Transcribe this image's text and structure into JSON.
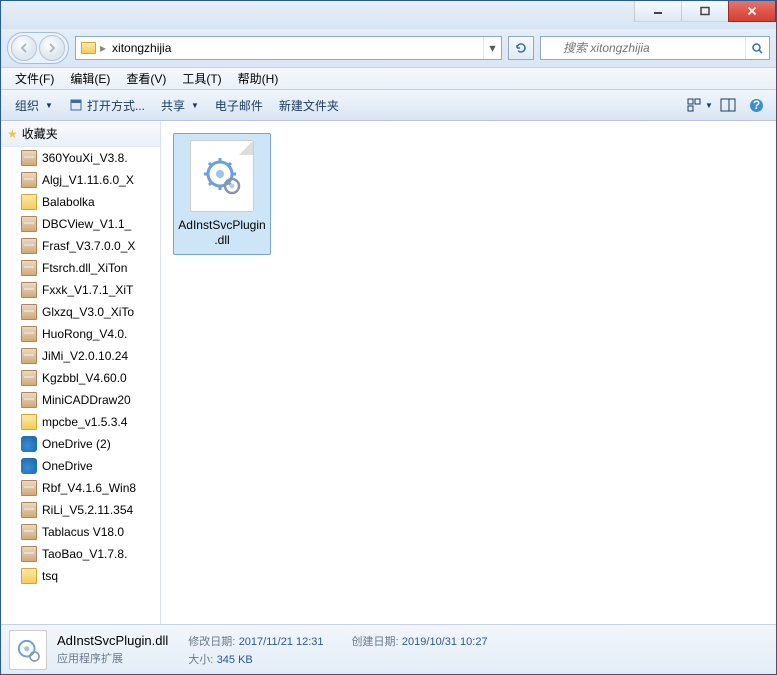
{
  "address": {
    "path": "xitongzhijia"
  },
  "search": {
    "placeholder": "搜索 xitongzhijia"
  },
  "menus": {
    "file": "文件(F)",
    "edit": "编辑(E)",
    "view": "查看(V)",
    "tools": "工具(T)",
    "help": "帮助(H)"
  },
  "toolbar": {
    "organize": "组织",
    "open_with": "打开方式...",
    "share": "共享",
    "email": "电子邮件",
    "new_folder": "新建文件夹"
  },
  "sidebar": {
    "header": "收藏夹",
    "items": [
      {
        "label": "360YouXi_V3.8.",
        "icon": "archive"
      },
      {
        "label": "Algj_V1.11.6.0_X",
        "icon": "archive"
      },
      {
        "label": "Balabolka",
        "icon": "folder"
      },
      {
        "label": "DBCView_V1.1_",
        "icon": "archive"
      },
      {
        "label": "Frasf_V3.7.0.0_X",
        "icon": "archive"
      },
      {
        "label": "Ftsrch.dll_XiTon",
        "icon": "archive"
      },
      {
        "label": "Fxxk_V1.7.1_XiT",
        "icon": "archive"
      },
      {
        "label": "Glxzq_V3.0_XiTo",
        "icon": "archive"
      },
      {
        "label": "HuoRong_V4.0.",
        "icon": "archive"
      },
      {
        "label": "JiMi_V2.0.10.24",
        "icon": "archive"
      },
      {
        "label": "Kgzbbl_V4.60.0",
        "icon": "archive"
      },
      {
        "label": "MiniCADDraw20",
        "icon": "archive"
      },
      {
        "label": "mpcbe_v1.5.3.4",
        "icon": "folder"
      },
      {
        "label": "OneDrive (2)",
        "icon": "onedrive"
      },
      {
        "label": "OneDrive",
        "icon": "onedrive"
      },
      {
        "label": "Rbf_V4.1.6_Win8",
        "icon": "archive"
      },
      {
        "label": "RiLi_V5.2.11.354",
        "icon": "archive"
      },
      {
        "label": "Tablacus V18.0",
        "icon": "archive"
      },
      {
        "label": "TaoBao_V1.7.8.",
        "icon": "archive"
      },
      {
        "label": "tsq",
        "icon": "folder"
      }
    ]
  },
  "content": {
    "file": {
      "name": "AdInstSvcPlugin.dll"
    }
  },
  "details": {
    "name": "AdInstSvcPlugin.dll",
    "type": "应用程序扩展",
    "modified_label": "修改日期:",
    "modified_value": "2017/11/21 12:31",
    "size_label": "大小:",
    "size_value": "345 KB",
    "created_label": "创建日期:",
    "created_value": "2019/10/31 10:27"
  }
}
